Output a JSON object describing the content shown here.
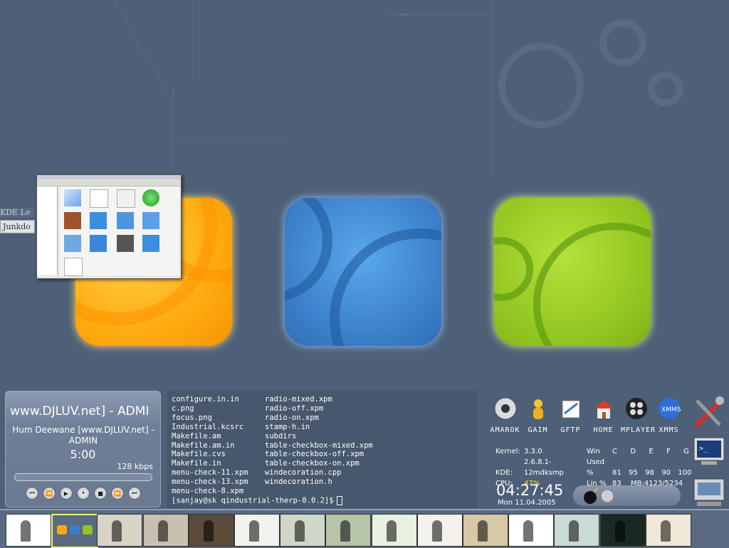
{
  "wallpaper": {
    "bg_color": "#4e5f78",
    "tiles": [
      "orange",
      "blue",
      "green"
    ]
  },
  "side_labels": {
    "kde": "KDE Le",
    "junk": "Junkdo"
  },
  "media_player": {
    "title_scroll": "www.DJLUV.net] - ADMI",
    "track_line": "Hum Deewane [www.DJLUV.net] - ADMIN",
    "time": "5:00",
    "bitrate": "128 kbps",
    "progress": 0.0,
    "controls": [
      "previous",
      "rewind",
      "play",
      "pause",
      "stop",
      "forward",
      "next"
    ]
  },
  "terminal": {
    "col1": [
      "configure.in.in",
      "c.png",
      "focus.png",
      "Industrial.kcsrc",
      "Makefile.am",
      "Makefile.am.in",
      "Makefile.cvs",
      "Makefile.in",
      "menu-check-11.xpm",
      "menu-check-13.xpm",
      "menu-check-8.xpm"
    ],
    "col2": [
      "radio-mixed.xpm",
      "radio-off.xpm",
      "radio-on.xpm",
      "stamp-h.in",
      "subdirs",
      "table-checkbox-mixed.xpm",
      "table-checkbox-off.xpm",
      "table-checkbox-on.xpm",
      "windecoration.cpp",
      "windecoration.h"
    ],
    "prompt": "[sanjay@sk qindustrial-therp-0.0.2]$"
  },
  "launchers": [
    {
      "label": "AMAROK",
      "icon": "amarok-icon"
    },
    {
      "label": "GAIM",
      "icon": "gaim-icon"
    },
    {
      "label": "GFTP",
      "icon": "gftp-icon"
    },
    {
      "label": "HOME",
      "icon": "home-icon"
    },
    {
      "label": "MPLAYER",
      "icon": "mplayer-icon"
    },
    {
      "label": "XMMS",
      "icon": "xmms-icon"
    }
  ],
  "stats": {
    "kernel_label": "Kernel:",
    "kernel": "3.3.0",
    "kde_label": "KDE:",
    "kde": "2.6.8.1-12mdksmp",
    "cpu_label": "CPU:",
    "cpu": "47%",
    "win_label": "Win",
    "drive_headers": "C  D  E  F  G",
    "used_label": "Used %",
    "used_values": "81  95  98  90  100",
    "lin_label": "Lin %",
    "lin_value": "83",
    "mb": "MB:4123/5234"
  },
  "clock": {
    "time": "04:27:45",
    "date": "Mon 11.04.2005"
  },
  "right_tools": [
    "tools-icon",
    "terminal-icon",
    "kcontrol-icon",
    "globe-icon"
  ],
  "taskbar": {
    "desktops": 15,
    "active_index": 1
  },
  "colors": {
    "accent_yellow": "#ffe23a",
    "panel": "#5a6a80"
  }
}
